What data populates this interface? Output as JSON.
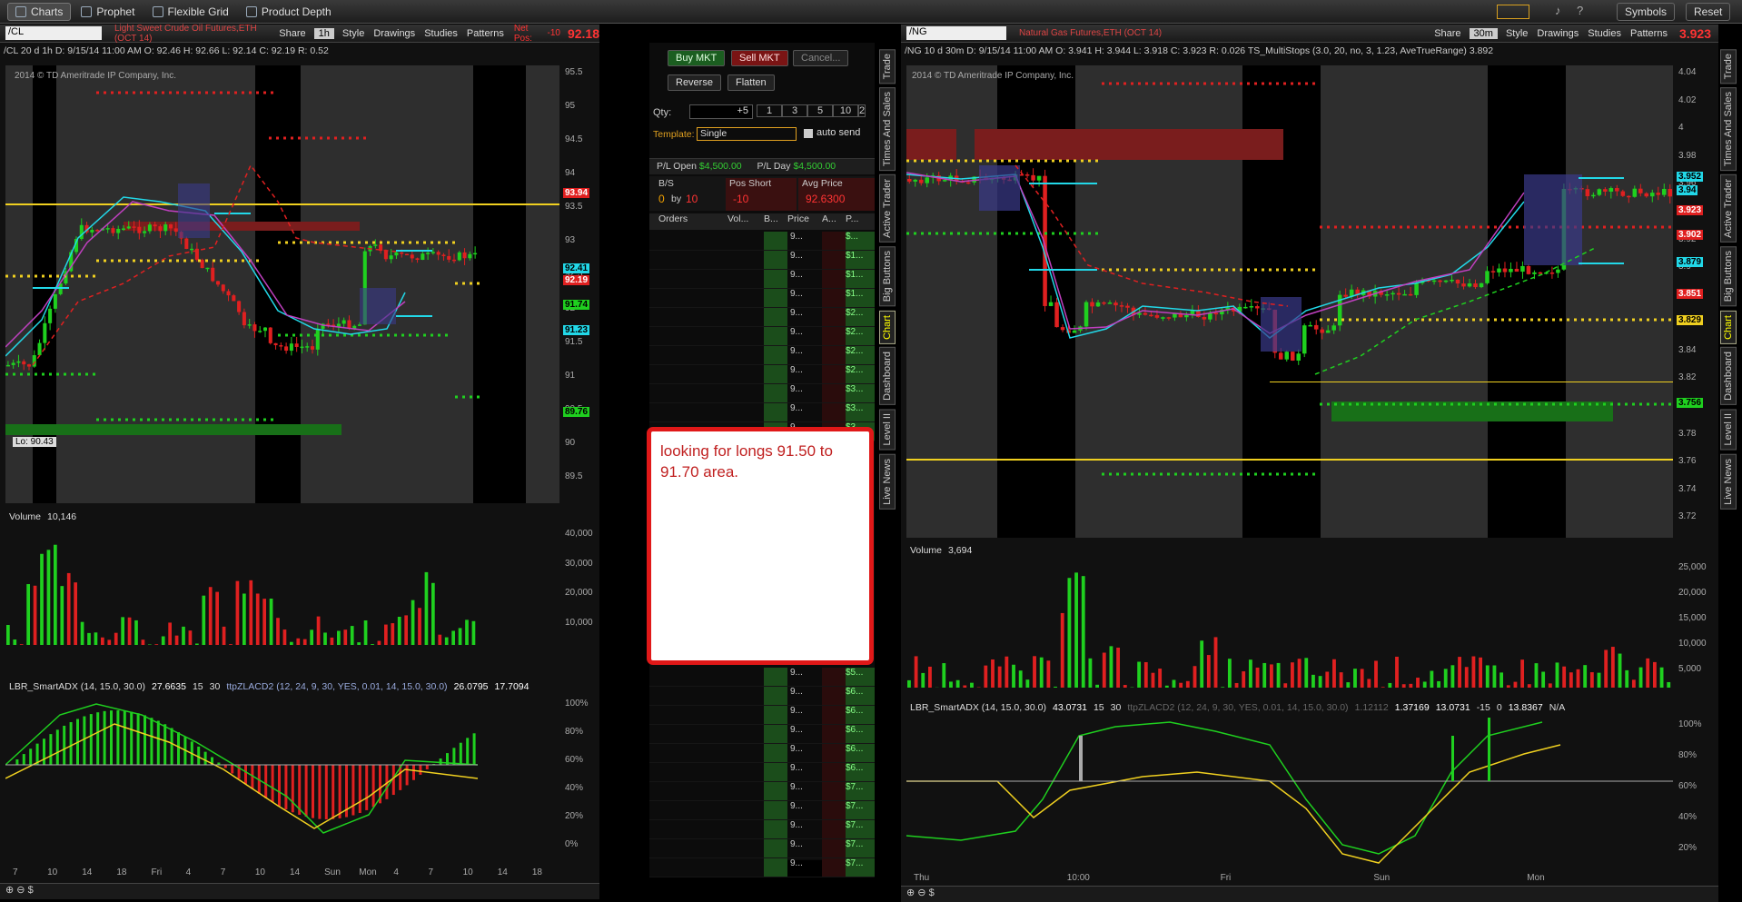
{
  "topbar": {
    "tabs": [
      "Charts",
      "Prophet",
      "Flexible Grid",
      "Product Depth"
    ],
    "active": "Charts",
    "right": [
      "Symbols",
      "Reset"
    ]
  },
  "left": {
    "symbol": "/CL",
    "desc": "Light Sweet Crude Oil Futures,ETH (OCT 14)",
    "share": "Share",
    "period": "1h",
    "style": "Style",
    "drawings": "Drawings",
    "studies": "Studies",
    "patterns": "Patterns",
    "netpos_label": "Net Pos:",
    "netpos_val": "-10",
    "last": "92.18",
    "ohlc": "/CL 20 d 1h   D: 9/15/14 11:00 AM   O: 92.46   H: 92.66   L: 92.14   C: 92.19   R: 0.52",
    "copyright": "2014 © TD Ameritrade IP Company, Inc.",
    "price_ticks": [
      "95.5",
      "95",
      "94.5",
      "94",
      "93.5",
      "93",
      "92.5",
      "92",
      "91.5",
      "91",
      "90.5",
      "90",
      "89.5"
    ],
    "tags": [
      "93.94",
      "92.41",
      "92.19",
      "91.74",
      "91.23",
      "89.76"
    ],
    "lo": "Lo: 90.43",
    "volume_label": "Volume",
    "volume_val": "10,146",
    "vol_ticks": [
      "40,000",
      "30,000",
      "20,000",
      "10,000"
    ],
    "ind_label": "LBR_SmartADX (14, 15.0, 30.0)",
    "ind_vals": [
      "27.6635",
      "15",
      "30",
      "ttpZLACD2 (12, 24, 9, 30, YES, 0.01, 14, 15.0, 30.0)",
      "26.0795",
      "17.7094"
    ],
    "ind_ticks": [
      "100%",
      "80%",
      "60%",
      "40%",
      "20%",
      "0%"
    ],
    "time_ticks": [
      "7",
      "10",
      "14",
      "18",
      "Fri",
      "4",
      "7",
      "10",
      "14",
      "Sun",
      "Mon",
      "4",
      "7",
      "10",
      "14",
      "18"
    ]
  },
  "right": {
    "symbol": "/NG",
    "desc": "Natural Gas Futures,ETH (OCT 14)",
    "share": "Share",
    "period": "30m",
    "style": "Style",
    "drawings": "Drawings",
    "studies": "Studies",
    "patterns": "Patterns",
    "last": "3.923",
    "ohlc": "/NG 10 d 30m   D: 9/15/14 11:00 AM   O: 3.941   H: 3.944   L: 3.918   C: 3.923   R: 0.026   TS_MultiStops (3.0, 20, no, 3, 1.23, AveTrueRange)   3.892",
    "copyright": "2014 © TD Ameritrade IP Company, Inc.",
    "price_ticks": [
      "4.04",
      "4.02",
      "4",
      "3.98",
      "3.96",
      "3.94",
      "3.92",
      "3.9",
      "3.88",
      "3.86",
      "3.84",
      "3.82",
      "3.8",
      "3.78",
      "3.76",
      "3.74",
      "3.72"
    ],
    "tags": [
      "3.952",
      "3.94",
      "3.923",
      "3.902",
      "3.879",
      "3.851",
      "3.829",
      "3.756"
    ],
    "volume_label": "Volume",
    "volume_val": "3,694",
    "vol_ticks": [
      "25,000",
      "20,000",
      "15,000",
      "10,000",
      "5,000"
    ],
    "ind_label": "LBR_SmartADX (14, 15.0, 30.0)",
    "ind_vals": [
      "43.0731",
      "15",
      "30",
      "ttpZLACD2 (12, 24, 9, 30, YES, 0.01, 14, 15.0, 30.0)",
      "1.12112",
      "1.37169",
      "13.0731",
      "-15",
      "0",
      "13.8367",
      "N/A"
    ],
    "ind_ticks": [
      "100%",
      "80%",
      "60%",
      "40%",
      "20%"
    ],
    "time_ticks": [
      "Thu",
      "10:00",
      "Fri",
      "Sun",
      "Mon"
    ]
  },
  "trader": {
    "buy": "Buy MKT",
    "sell": "Sell MKT",
    "cancel": "Cancel...",
    "reverse": "Reverse",
    "flatten": "Flatten",
    "qty_label": "Qty:",
    "qty": "+5",
    "qty_opts": [
      "1",
      "3",
      "5",
      "10",
      "2"
    ],
    "template_label": "Template:",
    "template": "Single",
    "autosend": "auto send",
    "pl_open": "P/L Open",
    "pl_open_val": "$4,500.00",
    "pl_day": "P/L Day",
    "pl_day_val": "$4,500.00",
    "bs": "B/S",
    "bs_val": "0",
    "by": "by",
    "bs_qty": "10",
    "pos_short": "Pos Short",
    "pos_val": "-10",
    "avg_label": "Avg Price",
    "avg_val": "92.6300",
    "cols": [
      "Orders",
      "Vol...",
      "B...",
      "Price",
      "A...",
      "P..."
    ],
    "ladder_prices": [
      "9...",
      "9...",
      "9...",
      "9...",
      "9...",
      "9...",
      "9...",
      "9...",
      "9...",
      "9...",
      "9..."
    ],
    "ladder_pl": [
      "$...",
      "$1...",
      "$1...",
      "$1...",
      "$2...",
      "$2...",
      "$2...",
      "$2...",
      "$3...",
      "$3...",
      "$3..."
    ],
    "ladder_prices_low": [
      "9...",
      "9...",
      "9...",
      "9...",
      "9...",
      "9...",
      "9...",
      "9...",
      "9...",
      "9...",
      "9..."
    ],
    "ladder_pl_low": [
      "$5...",
      "$6...",
      "$6...",
      "$6...",
      "$6...",
      "$6...",
      "$7...",
      "$7...",
      "$7...",
      "$7...",
      "$7..."
    ],
    "note": "looking for longs 91.50 to 91.70 area."
  },
  "sidetabs": [
    "Trade",
    "Times And Sales",
    "Active Trader",
    "Big Buttons",
    "Chart",
    "Dashboard",
    "Level II",
    "Live News"
  ],
  "colors": {
    "up": "#1fd01f",
    "down": "#e02020",
    "cyan": "#22d8e8",
    "yellow": "#f0d020",
    "magenta": "#c040c0"
  }
}
